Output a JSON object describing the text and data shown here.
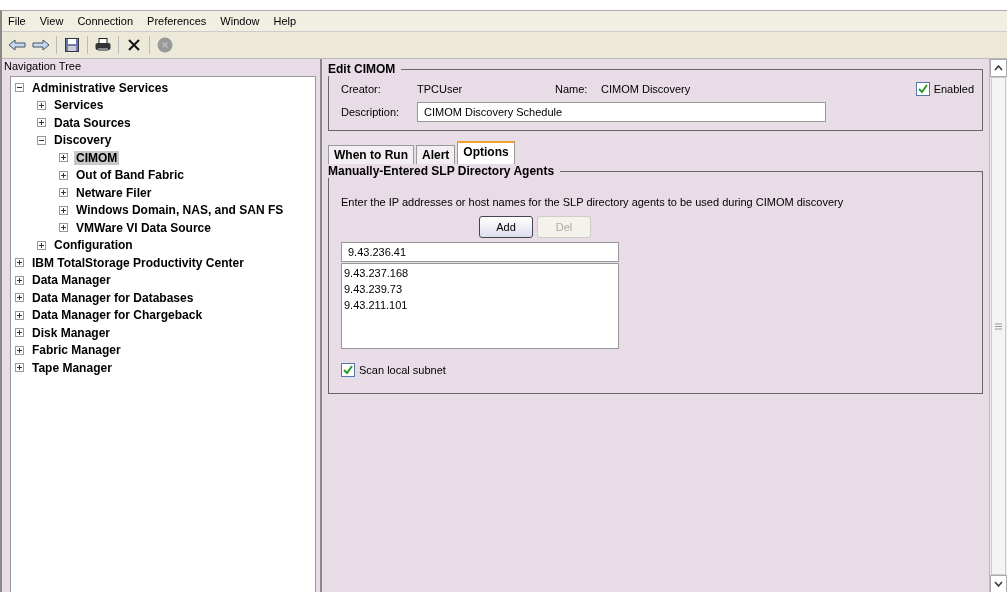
{
  "menu": [
    "File",
    "View",
    "Connection",
    "Preferences",
    "Window",
    "Help"
  ],
  "navigation": {
    "title": "Navigation Tree",
    "items": [
      {
        "label": "Administrative Services",
        "expanded": true,
        "selected": false,
        "children": [
          {
            "label": "Services",
            "expanded": false,
            "selected": false
          },
          {
            "label": "Data Sources",
            "expanded": false,
            "selected": false
          },
          {
            "label": "Discovery",
            "expanded": true,
            "selected": false,
            "children": [
              {
                "label": "CIMOM",
                "expanded": false,
                "selected": true
              },
              {
                "label": "Out of Band Fabric",
                "expanded": false,
                "selected": false
              },
              {
                "label": "Netware Filer",
                "expanded": false,
                "selected": false
              },
              {
                "label": "Windows Domain, NAS, and SAN FS",
                "expanded": false,
                "selected": false
              },
              {
                "label": "VMWare VI Data Source",
                "expanded": false,
                "selected": false
              }
            ]
          },
          {
            "label": "Configuration",
            "expanded": false,
            "selected": false
          }
        ]
      },
      {
        "label": "IBM TotalStorage Productivity Center",
        "expanded": false,
        "selected": false
      },
      {
        "label": "Data Manager",
        "expanded": false,
        "selected": false
      },
      {
        "label": "Data Manager for Databases",
        "expanded": false,
        "selected": false
      },
      {
        "label": "Data Manager for Chargeback",
        "expanded": false,
        "selected": false
      },
      {
        "label": "Disk Manager",
        "expanded": false,
        "selected": false
      },
      {
        "label": "Fabric Manager",
        "expanded": false,
        "selected": false
      },
      {
        "label": "Tape Manager",
        "expanded": false,
        "selected": false
      }
    ]
  },
  "edit": {
    "title": "Edit CIMOM",
    "creator_label": "Creator:",
    "creator": "TPCUser",
    "name_label": "Name:",
    "name": "CIMOM Discovery",
    "enabled": {
      "label": "Enabled",
      "checked": true
    },
    "description_label": "Description:",
    "description": "CIMOM Discovery Schedule"
  },
  "tabs": [
    {
      "label": "When to Run",
      "selected": false
    },
    {
      "label": "Alert",
      "selected": false
    },
    {
      "label": "Options",
      "selected": true
    }
  ],
  "agents": {
    "title": "Manually-Entered SLP Directory Agents",
    "instruction": "Enter the IP addresses or host names for the SLP directory agents to be used during CIMOM discovery",
    "buttons": [
      {
        "label": "Add",
        "disabled": false
      },
      {
        "label": "Del",
        "disabled": true
      }
    ],
    "entry": "9.43.236.41",
    "list": [
      "9.43.237.168",
      "9.43.239.73",
      "9.43.211.101"
    ],
    "scan": {
      "label": "Scan local subnet",
      "checked": true
    }
  }
}
